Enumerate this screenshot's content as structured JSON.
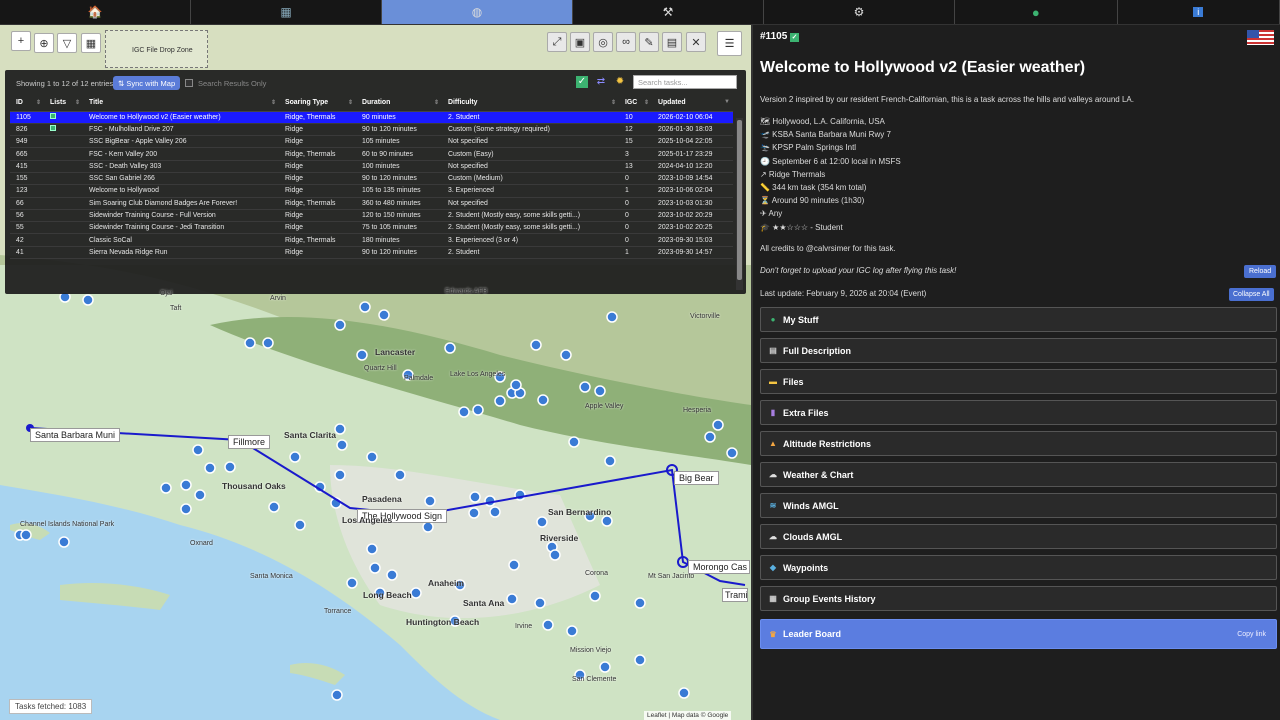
{
  "nav": {
    "tabs": [
      {
        "icon": "home-icon",
        "glyph": "🏠",
        "active": false
      },
      {
        "icon": "calendar-icon",
        "glyph": "▦",
        "active": false
      },
      {
        "icon": "globe-icon",
        "glyph": "◍",
        "active": true
      },
      {
        "icon": "tools-icon",
        "glyph": "⚒",
        "active": false
      },
      {
        "icon": "gear-icon",
        "glyph": "⚙",
        "active": false
      },
      {
        "icon": "user-icon",
        "glyph": "●",
        "active": false
      },
      {
        "icon": "info-icon",
        "glyph": "i",
        "active": false
      }
    ]
  },
  "map": {
    "zoom_in": "+",
    "zoom_out": "−",
    "drop_zone": "IGC File Drop Zone",
    "tasks_fetched": "Tasks fetched: 1083",
    "attribution": "Leaflet | Map data © Google",
    "route_labels": [
      "Santa Barbara Muni",
      "Fillmore",
      "The Hollywood Sign",
      "Big Bear",
      "Morongo Cas",
      "Trami"
    ],
    "cities": [
      "Lancaster",
      "Santa Clarita",
      "Los Angeles",
      "Thousand Oaks",
      "Pasadena",
      "San Bernardino",
      "Riverside",
      "Long Beach",
      "Anaheim",
      "Santa Ana",
      "Huntington Beach",
      "Victorville",
      "Apple Valley",
      "Palmdale",
      "Hesperia",
      "Oxnard",
      "Santa Monica",
      "Torrance",
      "Corona",
      "Irvine",
      "Mission Viejo",
      "San Clemente",
      "Ojai",
      "Quartz Hill",
      "Lake Los Angeles",
      "Channel Islands National Park",
      "Mt San Jacinto",
      "Edwards AFB",
      "Taft",
      "Arvin"
    ],
    "accent": "#1a1acc"
  },
  "table": {
    "entries_info": "Showing 1 to 12 of 12 entries",
    "sync_label": "⇅ Sync with Map",
    "search_only_label": "Search Results Only",
    "search_placeholder": "Search tasks...",
    "columns": [
      "ID",
      "Lists",
      "Title",
      "Soaring Type",
      "Duration",
      "Difficulty",
      "IGC",
      "Updated"
    ],
    "rows": [
      {
        "id": "1105",
        "list": true,
        "title": "Welcome to Hollywood v2 (Easier weather)",
        "type": "Ridge, Thermals",
        "duration": "90 minutes",
        "difficulty": "2. Student",
        "igc": "10",
        "updated": "2026-02-10 06:04",
        "selected": true
      },
      {
        "id": "826",
        "list": true,
        "title": "FSC - Mulholland Drive 207",
        "type": "Ridge",
        "duration": "90 to 120 minutes",
        "difficulty": "Custom (Some strategy required)",
        "igc": "12",
        "updated": "2026-01-30 18:03",
        "selected": false
      },
      {
        "id": "949",
        "list": false,
        "title": "SSC BigBear - Apple Valley 206",
        "type": "Ridge",
        "duration": "105 minutes",
        "difficulty": "Not specified",
        "igc": "15",
        "updated": "2025-10-04 22:05",
        "selected": false
      },
      {
        "id": "665",
        "list": false,
        "title": "FSC - Kern Valley 200",
        "type": "Ridge, Thermals",
        "duration": "60 to 90 minutes",
        "difficulty": "Custom (Easy)",
        "igc": "3",
        "updated": "2025-01-17 23:29",
        "selected": false
      },
      {
        "id": "415",
        "list": false,
        "title": "SSC - Death Valley 303",
        "type": "Ridge",
        "duration": "100 minutes",
        "difficulty": "Not specified",
        "igc": "13",
        "updated": "2024-04-10 12:20",
        "selected": false
      },
      {
        "id": "155",
        "list": false,
        "title": "SSC San Gabriel 266",
        "type": "Ridge",
        "duration": "90 to 120 minutes",
        "difficulty": "Custom (Medium)",
        "igc": "0",
        "updated": "2023-10-09 14:54",
        "selected": false
      },
      {
        "id": "123",
        "list": false,
        "title": "Welcome to Hollywood",
        "type": "Ridge",
        "duration": "105 to 135 minutes",
        "difficulty": "3. Experienced",
        "igc": "1",
        "updated": "2023-10-06 02:04",
        "selected": false
      },
      {
        "id": "66",
        "list": false,
        "title": "Sim Soaring Club Diamond Badges Are Forever!",
        "type": "Ridge, Thermals",
        "duration": "360 to 480 minutes",
        "difficulty": "Not specified",
        "igc": "0",
        "updated": "2023-10-03 01:30",
        "selected": false
      },
      {
        "id": "56",
        "list": false,
        "title": "Sidewinder Training Course - Full Version",
        "type": "Ridge",
        "duration": "120 to 150 minutes",
        "difficulty": "2. Student (Mostly easy, some skills getti...)",
        "igc": "0",
        "updated": "2023-10-02 20:29",
        "selected": false
      },
      {
        "id": "55",
        "list": false,
        "title": "Sidewinder Training Course - Jedi Transition",
        "type": "Ridge",
        "duration": "75 to 105 minutes",
        "difficulty": "2. Student (Mostly easy, some skills getti...)",
        "igc": "0",
        "updated": "2023-10-02 20:25",
        "selected": false
      },
      {
        "id": "42",
        "list": false,
        "title": "Classic SoCal",
        "type": "Ridge, Thermals",
        "duration": "180 minutes",
        "difficulty": "3. Experienced (3 or 4)",
        "igc": "0",
        "updated": "2023-09-30 15:03",
        "selected": false
      },
      {
        "id": "41",
        "list": false,
        "title": "Sierra Nevada Ridge Run",
        "type": "Ridge",
        "duration": "90 to 120 minutes",
        "difficulty": "2. Student",
        "igc": "1",
        "updated": "2023-09-30 14:57",
        "selected": false
      }
    ]
  },
  "detail": {
    "task_id": "#1105",
    "title": "Welcome to Hollywood v2 (Easier weather)",
    "description": "Version 2 inspired by our resident French-Californian, this is a task across the hills and valleys around LA.",
    "facts": [
      "🗺 Hollywood, L.A. California, USA",
      "🛫 KSBA Santa Barbara Muni Rwy 7",
      "🛬 KPSP Palm Springs Intl",
      "🕘 September 6 at 12:00 local in MSFS",
      "↗ Ridge Thermals",
      "📏 344 km task (354 km total)",
      "⏳ Around 90 minutes (1h30)",
      "✈ Any",
      "🎓 ★★☆☆☆ - Student"
    ],
    "credits": "All credits to @calvrsimer for this task.",
    "upload_note": "Don't forget to upload your IGC log after flying this task!",
    "reload_label": "Reload",
    "last_update": "Last update: February 9, 2026 at 20:04 (Event)",
    "collapse_label": "Collapse All",
    "sections": [
      {
        "label": "My Stuff",
        "icon": "user-icon",
        "glyph": "●",
        "color": "#3cb371"
      },
      {
        "label": "Full Description",
        "icon": "document-icon",
        "glyph": "▤",
        "color": "#ccc"
      },
      {
        "label": "Files",
        "icon": "folder-icon",
        "glyph": "▬",
        "color": "#f5c542"
      },
      {
        "label": "Extra Files",
        "icon": "file-icon",
        "glyph": "▮",
        "color": "#a77ee0"
      },
      {
        "label": "Altitude Restrictions",
        "icon": "warning-icon",
        "glyph": "▲",
        "color": "#f5a742"
      },
      {
        "label": "Weather & Chart",
        "icon": "cloud-icon",
        "glyph": "☁",
        "color": "#ddd"
      },
      {
        "label": "Winds AMGL",
        "icon": "wind-icon",
        "glyph": "≋",
        "color": "#5ab0e0"
      },
      {
        "label": "Clouds AMGL",
        "icon": "cloud-icon",
        "glyph": "☁",
        "color": "#ddd"
      },
      {
        "label": "Waypoints",
        "icon": "waypoints-icon",
        "glyph": "◆",
        "color": "#5ab0e0"
      },
      {
        "label": "Group Events History",
        "icon": "calendar-icon",
        "glyph": "▦",
        "color": "#ccc"
      },
      {
        "label": "Leader Board",
        "icon": "trophy-icon",
        "glyph": "♛",
        "color": "#f5a742"
      }
    ],
    "copy_link": "Copy link"
  }
}
